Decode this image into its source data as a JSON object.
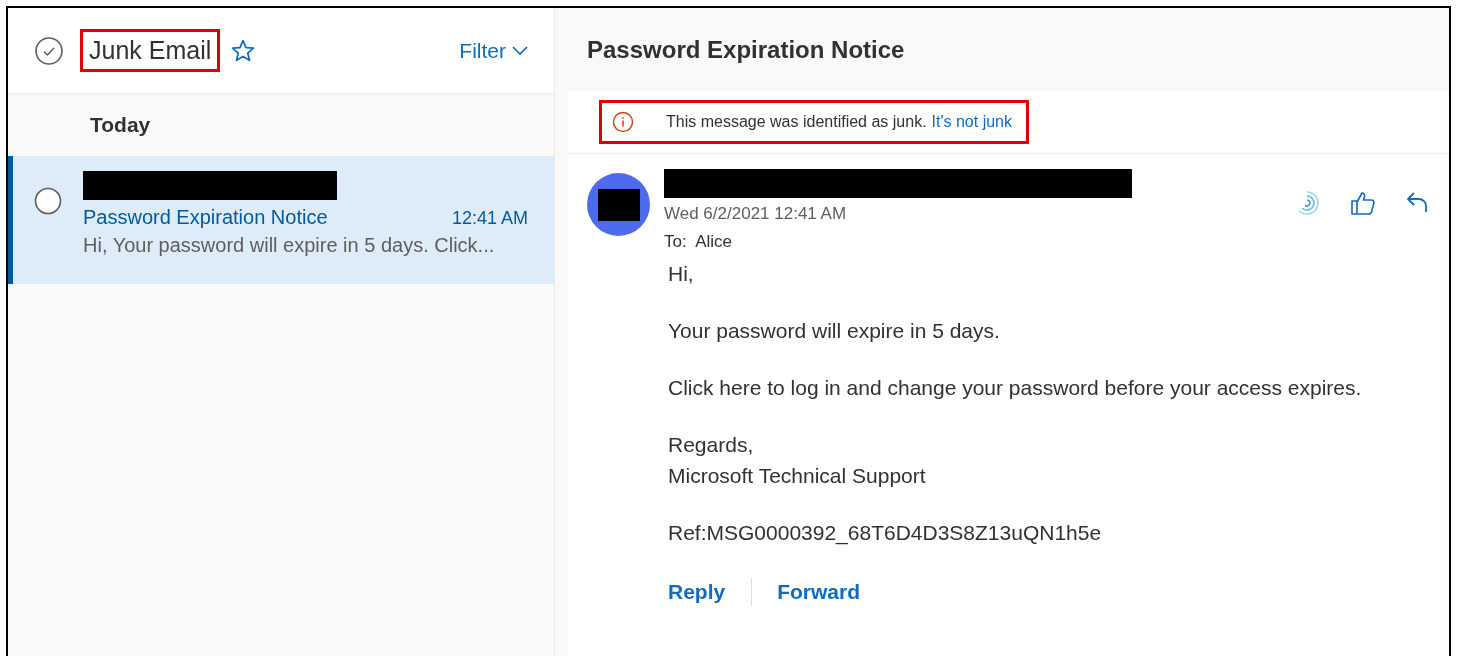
{
  "folder": {
    "title": "Junk Email",
    "annotated": true,
    "filter": "Filter"
  },
  "groups": [
    {
      "label": "Today",
      "messages": [
        {
          "subject": "Password Expiration Notice",
          "time": "12:41 AM",
          "preview": "Hi, Your password will expire in 5 days. Click...",
          "selected": true,
          "checked": false
        }
      ]
    }
  ],
  "reading": {
    "title": "Password Expiration Notice",
    "notice": {
      "text": "This message was identified as junk.",
      "link": "It's not junk",
      "annotated": true
    },
    "date": "Wed 6/2/2021 12:41 AM",
    "to_label": "To:",
    "to": "Alice",
    "body": [
      [
        "Hi,"
      ],
      [
        "Your password will expire in 5 days."
      ],
      [
        "Click here to log in and change your password before your access expires."
      ],
      [
        "Regards,",
        "Microsoft Technical Support"
      ],
      [
        "Ref:MSG0000392_68T6D4D3S8Z13uQN1h5e"
      ]
    ],
    "actions": [
      "Reply",
      "Forward"
    ]
  }
}
